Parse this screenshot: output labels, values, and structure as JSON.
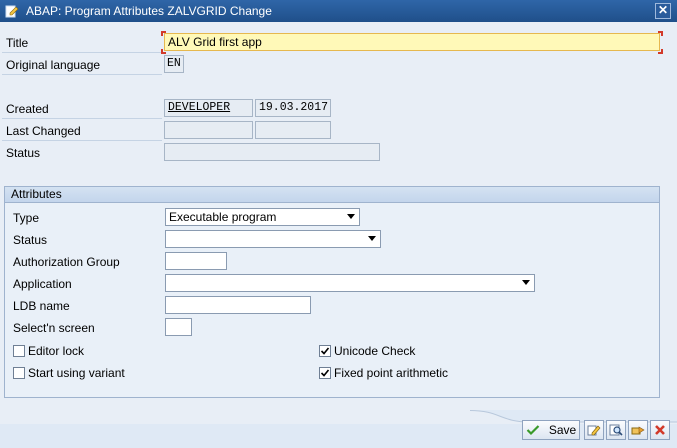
{
  "window": {
    "title": "ABAP: Program Attributes ZALVGRID Change",
    "close_glyph": "✕"
  },
  "header_fields": {
    "title_label": "Title",
    "title_value": "ALV Grid first app",
    "orig_lang_label": "Original language",
    "orig_lang_value": "EN",
    "created_label": "Created",
    "created_user": "DEVELOPER",
    "created_date": "19.03.2017",
    "last_changed_label": "Last Changed",
    "last_changed_user": "",
    "last_changed_date": "",
    "status_label": "Status",
    "status_value": ""
  },
  "attributes": {
    "header": "Attributes",
    "type_label": "Type",
    "type_value": "Executable program",
    "status_label": "Status",
    "status_value": "",
    "auth_group_label": "Authorization Group",
    "auth_group_value": "",
    "application_label": "Application",
    "application_value": "",
    "ldb_label": "LDB name",
    "ldb_value": "",
    "selscreen_label": "Select'n screen",
    "selscreen_value": "",
    "editor_lock_label": "Editor lock",
    "editor_lock_checked": false,
    "start_variant_label": "Start using variant",
    "start_variant_checked": false,
    "unicode_label": "Unicode Check",
    "unicode_checked": true,
    "fixed_point_label": "Fixed point arithmetic",
    "fixed_point_checked": true
  },
  "footer": {
    "save_label": "Save",
    "icons": [
      "check-icon",
      "edit-icon",
      "search-icon",
      "transport-icon",
      "cancel-icon"
    ]
  },
  "colors": {
    "titlebar": "#1f4f8a",
    "title_input_bg": "#fff9b8",
    "save_check": "#3a9a2a",
    "cancel": "#d23a2a"
  }
}
